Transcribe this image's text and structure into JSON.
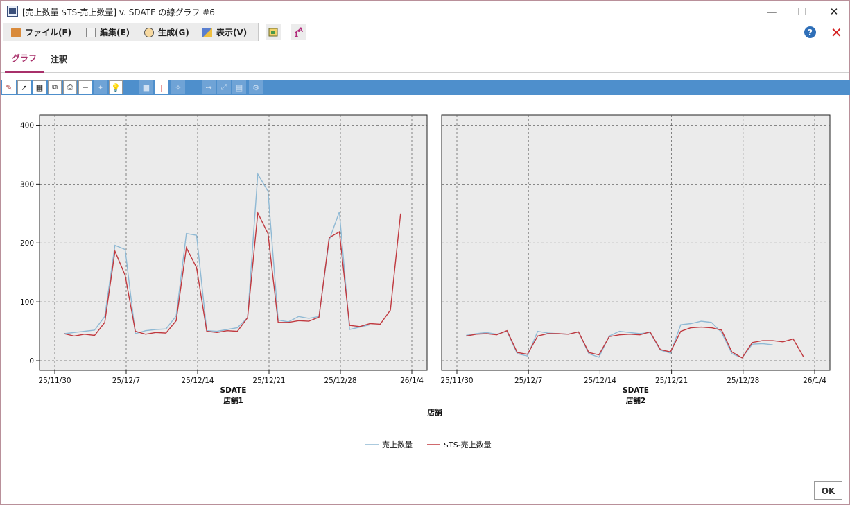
{
  "window": {
    "title": "[売上数量 $TS-売上数量] v. SDATE の線グラフ #6",
    "minimize_glyph": "—",
    "maximize_glyph": "☐",
    "close_glyph": "✕"
  },
  "menu": {
    "items": [
      {
        "label": "ファイル(F)",
        "icon": "file-icon"
      },
      {
        "label": "編集(E)",
        "icon": "edit-icon"
      },
      {
        "label": "生成(G)",
        "icon": "generate-icon"
      },
      {
        "label": "表示(V)",
        "icon": "view-icon"
      }
    ],
    "help_glyph": "?",
    "close_glyph": "✕"
  },
  "tabs": [
    {
      "label": "グラフ",
      "active": true
    },
    {
      "label": "注釈",
      "active": false
    }
  ],
  "ok_label": "OK",
  "colors": {
    "accent": "#a8306a",
    "toolbar": "#4e8fcc",
    "plot_bg": "#ebebeb",
    "series_actual": "#8fb9d4",
    "series_ts": "#c0393f"
  },
  "chart_data": {
    "type": "line",
    "xlabel": "SDATE",
    "group_label": "店舗",
    "ylim": [
      0,
      410
    ],
    "yticks": [
      0,
      100,
      200,
      300,
      400
    ],
    "xticks": [
      "25/11/30",
      "25/12/7",
      "25/12/14",
      "25/12/21",
      "25/12/28",
      "26/1/4"
    ],
    "grid": true,
    "legend_position": "bottom",
    "legend": [
      "売上数量",
      "$TS-売上数量"
    ],
    "panels": [
      {
        "label": "店舗1",
        "series": [
          {
            "name": "売上数量",
            "values": [
              46,
              48,
              50,
              52,
              75,
              196,
              189,
              46,
              51,
              53,
              54,
              76,
              216,
              213,
              51,
              50,
              53,
              56,
              73,
              317,
              288,
              69,
              66,
              75,
              72,
              75,
              205,
              253,
              53,
              57,
              61,
              null,
              null,
              null
            ]
          },
          {
            "name": "$TS-売上数量",
            "values": [
              46,
              42,
              45,
              43,
              65,
              186,
              145,
              50,
              45,
              48,
              47,
              68,
              192,
              158,
              50,
              48,
              51,
              50,
              73,
              251,
              216,
              65,
              65,
              68,
              67,
              74,
              209,
              219,
              60,
              58,
              63,
              62,
              86,
              250
            ]
          }
        ]
      },
      {
        "label": "店舗2",
        "series": [
          {
            "name": "売上数量",
            "values": [
              43,
              46,
              48,
              45,
              50,
              12,
              8,
              50,
              47,
              46,
              45,
              49,
              12,
              6,
              42,
              50,
              48,
              46,
              48,
              18,
              13,
              61,
              63,
              67,
              65,
              48,
              12,
              5,
              28,
              29,
              27,
              null,
              null,
              null
            ]
          },
          {
            "name": "$TS-売上数量",
            "values": [
              42,
              45,
              46,
              44,
              51,
              14,
              11,
              42,
              46,
              46,
              45,
              49,
              14,
              10,
              41,
              44,
              45,
              44,
              49,
              19,
              15,
              50,
              56,
              57,
              56,
              52,
              15,
              5,
              31,
              34,
              34,
              32,
              37,
              7
            ]
          }
        ]
      }
    ]
  }
}
